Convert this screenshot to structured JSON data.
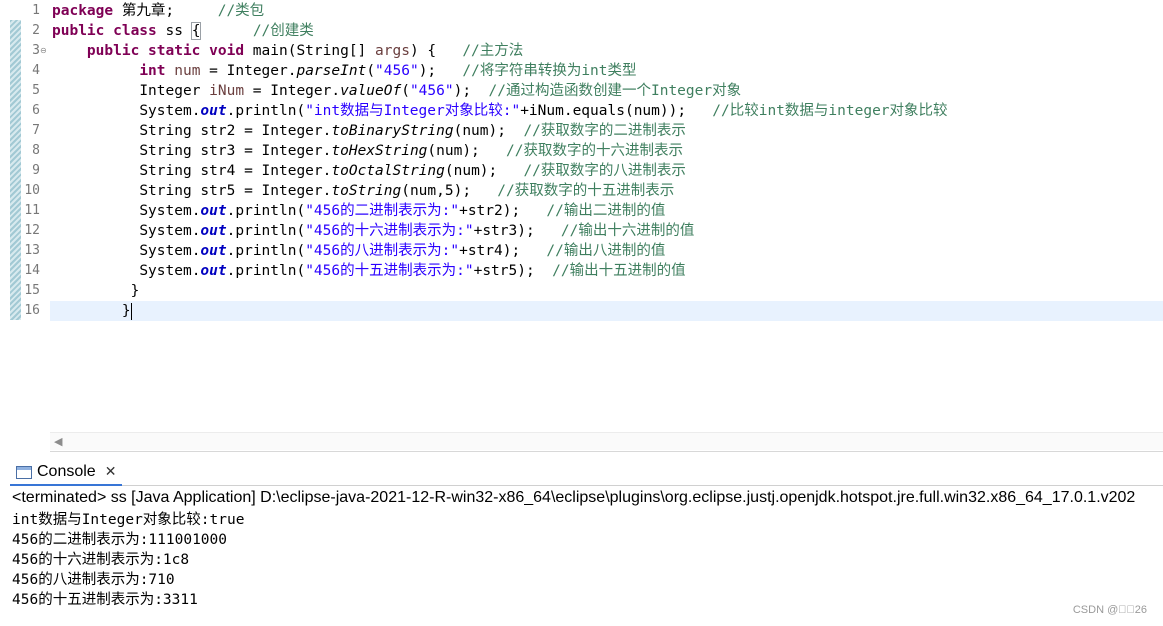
{
  "editor": {
    "line_numbers": [
      "1",
      "2",
      "3",
      "4",
      "5",
      "6",
      "7",
      "8",
      "9",
      "10",
      "11",
      "12",
      "13",
      "14",
      "15",
      "16"
    ],
    "fold_marker": "⊖",
    "lines": {
      "l1": {
        "kw": "package",
        "name": " 第九章;     ",
        "comment": "//类包"
      },
      "l2": {
        "kw": "public class",
        "name": " ss ",
        "brace": "{",
        "pad": "      ",
        "comment": "//创建类"
      },
      "l3": {
        "indent": "    ",
        "kw": "public static void",
        "rest": " main(String[] ",
        "args": "args",
        "rest2": ") {   ",
        "comment": "//主方法"
      },
      "l4": {
        "indent": "          ",
        "kw": "int",
        "var": " num",
        "a": " = Integer.",
        "method": "parseInt",
        "b": "(",
        "str": "\"456\"",
        "c": ");   ",
        "comment": "//将字符串转换为int类型"
      },
      "l5": {
        "indent": "          ",
        "type": "Integer ",
        "var": "iNum",
        "a": " = Integer.",
        "method": "valueOf",
        "b": "(",
        "str": "\"456\"",
        "c": ");  ",
        "comment": "//通过构造函数创建一个Integer对象"
      },
      "l6": {
        "indent": "          ",
        "a": "System.",
        "field": "out",
        "b": ".println(",
        "str": "\"int数据与Integer对象比较:\"",
        "c": "+iNum.equals(num));   ",
        "comment": "//比较int数据与integer对象比较"
      },
      "l7": {
        "indent": "          ",
        "a": "String str2 = Integer.",
        "method": "toBinaryString",
        "b": "(num);  ",
        "comment": "//获取数字的二进制表示"
      },
      "l8": {
        "indent": "          ",
        "a": "String str3 = Integer.",
        "method": "toHexString",
        "b": "(num);   ",
        "comment": "//获取数字的十六进制表示"
      },
      "l9": {
        "indent": "          ",
        "a": "String str4 = Integer.",
        "method": "toOctalString",
        "b": "(num);   ",
        "comment": "//获取数字的八进制表示"
      },
      "l10": {
        "indent": "          ",
        "a": "String str5 = Integer.",
        "method": "toString",
        "b": "(num,5);   ",
        "comment": "//获取数字的十五进制表示"
      },
      "l11": {
        "indent": "          ",
        "a": "System.",
        "field": "out",
        "b": ".println(",
        "str": "\"456的二进制表示为:\"",
        "c": "+str2);   ",
        "comment": "//输出二进制的值"
      },
      "l12": {
        "indent": "          ",
        "a": "System.",
        "field": "out",
        "b": ".println(",
        "str": "\"456的十六进制表示为:\"",
        "c": "+str3);   ",
        "comment": "//输出十六进制的值"
      },
      "l13": {
        "indent": "          ",
        "a": "System.",
        "field": "out",
        "b": ".println(",
        "str": "\"456的八进制表示为:\"",
        "c": "+str4);   ",
        "comment": "//输出八进制的值"
      },
      "l14": {
        "indent": "          ",
        "a": "System.",
        "field": "out",
        "b": ".println(",
        "str": "\"456的十五进制表示为:\"",
        "c": "+str5);  ",
        "comment": "//输出十五进制的值"
      },
      "l15": {
        "indent": "         ",
        "text": "}"
      },
      "l16": {
        "indent": "        ",
        "text": "}"
      }
    },
    "scroll_left_arrow": "◀"
  },
  "console": {
    "tab_label": "Console",
    "close_glyph": "✕",
    "status": "<terminated> ss [Java Application] D:\\eclipse-java-2021-12-R-win32-x86_64\\eclipse\\plugins\\org.eclipse.justj.openjdk.hotspot.jre.full.win32.x86_64_17.0.1.v202",
    "output": [
      "int数据与Integer对象比较:true",
      "456的二进制表示为:111001000",
      "456的十六进制表示为:1c8",
      "456的八进制表示为:710",
      "456的十五进制表示为:3311"
    ]
  },
  "watermark": "CSDN @\u0000\u000026",
  "colors": {
    "keyword": "#7f0055",
    "comment": "#3f7f5f",
    "string": "#2a00ff",
    "field": "#0000c0",
    "current_line": "#e8f2fe"
  }
}
